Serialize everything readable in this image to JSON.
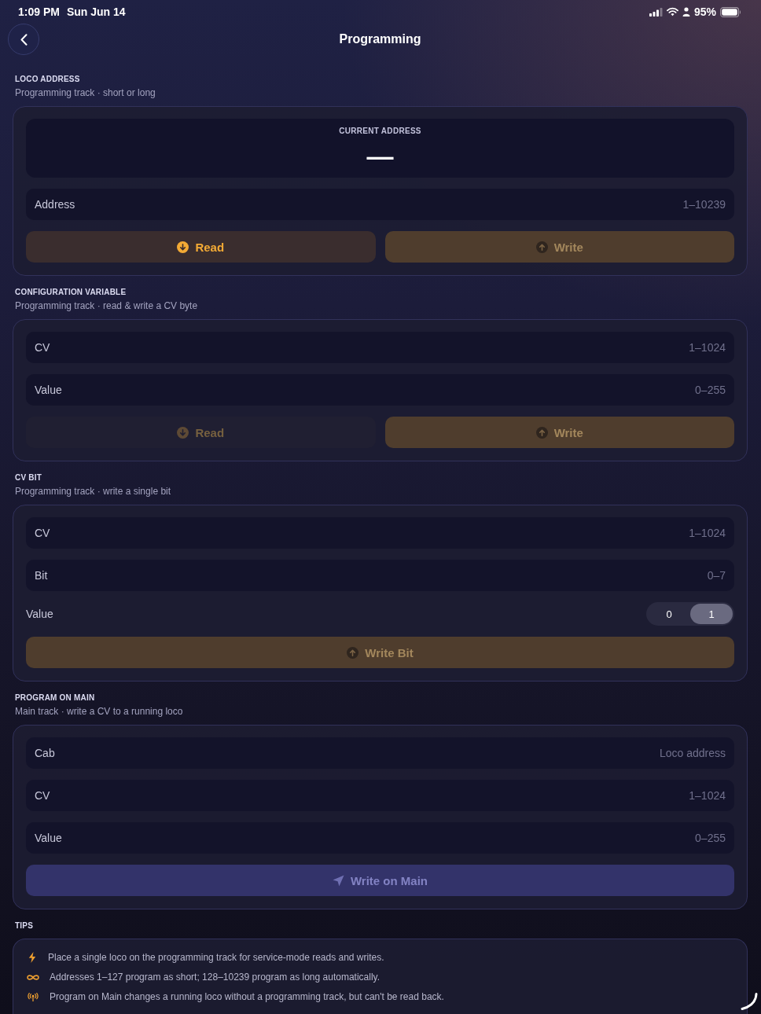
{
  "status_bar": {
    "time": "1:09 PM",
    "date": "Sun Jun 14",
    "battery": "95%"
  },
  "header": {
    "title": "Programming"
  },
  "sections": [
    {
      "heading": "LOCO ADDRESS",
      "subtitle": "Programming track · short or long",
      "rows": [
        {
          "kind": "display",
          "label": "CURRENT ADDRESS",
          "value": "—"
        },
        {
          "kind": "field",
          "label": "Address",
          "placeholder": "1–10239"
        },
        {
          "kind": "buttons",
          "buttons": [
            {
              "kind": "read",
              "label": "Read",
              "disabled": false
            },
            {
              "kind": "write",
              "label": "Write",
              "disabled": true
            }
          ]
        }
      ]
    },
    {
      "heading": "CONFIGURATION VARIABLE",
      "subtitle": "Programming track · read & write a CV byte",
      "rows": [
        {
          "kind": "field",
          "label": "CV",
          "placeholder": "1–1024"
        },
        {
          "kind": "field",
          "label": "Value",
          "placeholder": "0–255"
        },
        {
          "kind": "buttons",
          "buttons": [
            {
              "kind": "read",
              "label": "Read",
              "disabled": true
            },
            {
              "kind": "write",
              "label": "Write",
              "disabled": true
            }
          ]
        }
      ]
    },
    {
      "heading": "CV BIT",
      "subtitle": "Programming track · write a single bit",
      "rows": [
        {
          "kind": "field",
          "label": "CV",
          "placeholder": "1–1024"
        },
        {
          "kind": "field",
          "label": "Bit",
          "placeholder": "0–7"
        },
        {
          "kind": "toggle",
          "label": "Value",
          "options": [
            {
              "label": "0",
              "selected": false
            },
            {
              "label": "1",
              "selected": true
            }
          ]
        },
        {
          "kind": "buttons",
          "buttons": [
            {
              "kind": "write",
              "label": "Write Bit",
              "disabled": true
            }
          ]
        }
      ]
    },
    {
      "heading": "PROGRAM ON MAIN",
      "subtitle": "Main track · write a CV to a running loco",
      "rows": [
        {
          "kind": "field",
          "label": "Cab",
          "placeholder": "Loco address"
        },
        {
          "kind": "field",
          "label": "CV",
          "placeholder": "1–1024"
        },
        {
          "kind": "field",
          "label": "Value",
          "placeholder": "0–255"
        },
        {
          "kind": "buttons",
          "buttons": [
            {
              "kind": "send",
              "label": "Write on Main",
              "disabled": true
            }
          ]
        }
      ]
    }
  ],
  "tips": {
    "heading": "TIPS",
    "items": [
      {
        "kind": "bolt",
        "text": "Place a single loco on the programming track for service-mode reads and writes."
      },
      {
        "kind": "infinity",
        "text": "Addresses 1–127 program as short; 128–10239 program as long automatically."
      },
      {
        "kind": "broadcast",
        "text": "Program on Main changes a running loco without a programming track, but can't be read back."
      }
    ]
  }
}
